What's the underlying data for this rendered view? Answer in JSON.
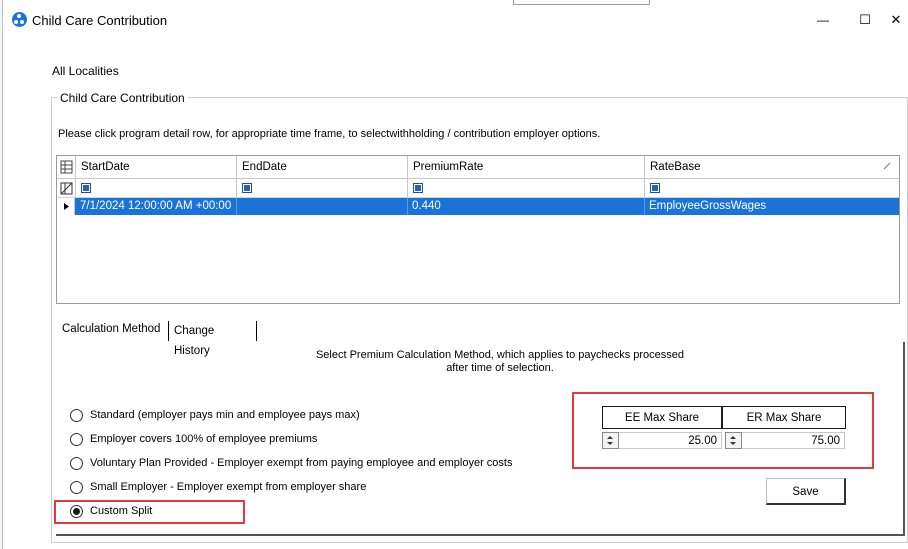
{
  "window": {
    "title": "Child Care Contribution",
    "minimize_glyph": "—",
    "maximize_glyph": "☐",
    "close_glyph": "✕"
  },
  "locality_label": "All Localities",
  "group": {
    "legend": "Child Care Contribution",
    "instructions": "Please click program detail row, for appropriate time frame, to selectwithholding / contribution employer options."
  },
  "grid": {
    "columns": [
      "StartDate",
      "EndDate",
      "PremiumRate",
      "RateBase"
    ],
    "rows": [
      {
        "start_date": "7/1/2024 12:00:00 AM +00:00",
        "end_date": "",
        "premium_rate": "0.440",
        "rate_base": "EmployeeGrossWages"
      }
    ]
  },
  "tabs": {
    "calculation": "Calculation Method",
    "history": "Change History"
  },
  "method": {
    "desc_line1": "Select Premium Calculation Method, which applies to paychecks processed",
    "desc_line2": "after time of selection.",
    "options": [
      "Standard (employer pays min and employee pays max)",
      "Employer covers 100% of employee premiums",
      "Voluntary Plan Provided - Employer exempt from paying employee and employer costs",
      "Small Employer - Employer exempt from employer share",
      "Custom Split"
    ],
    "selected_index": 4
  },
  "split": {
    "ee_label": "EE Max Share",
    "er_label": "ER Max Share",
    "ee_value": "25.00",
    "er_value": "75.00"
  },
  "save_label": "Save",
  "colors": {
    "selection": "#1a73d9",
    "highlight_box": "#e0393e",
    "app_icon": "#1e73d8"
  }
}
